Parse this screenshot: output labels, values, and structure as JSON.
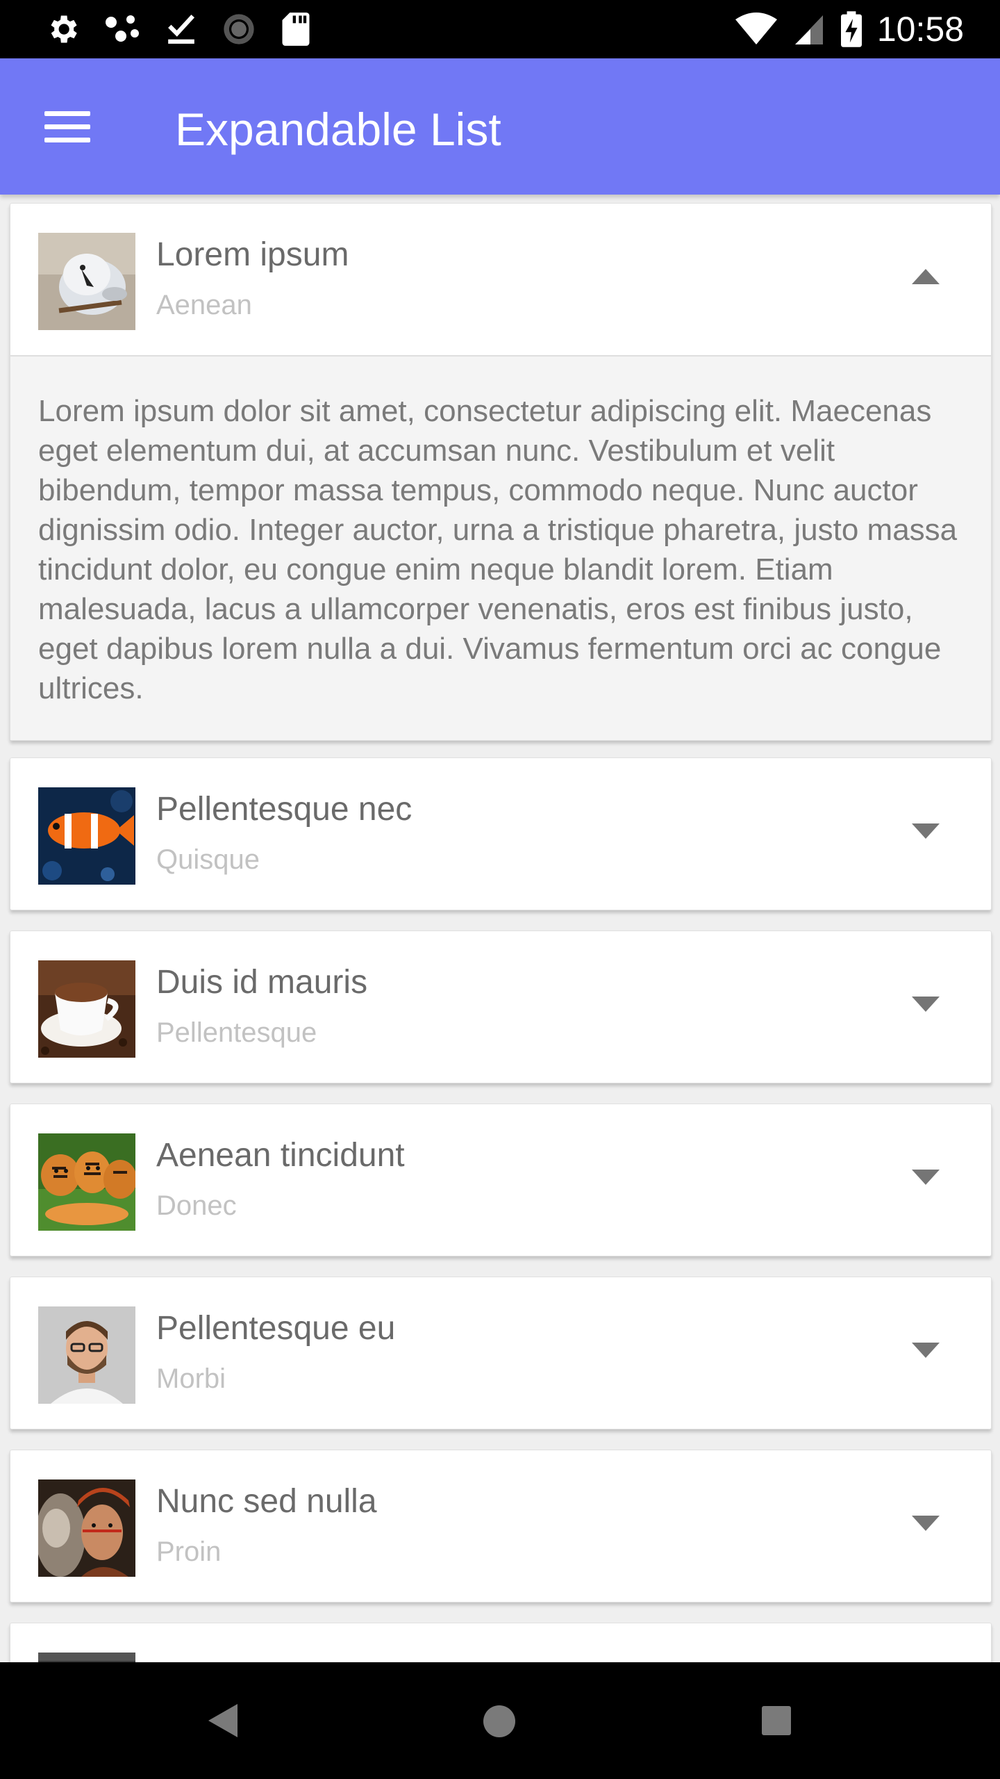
{
  "status_bar": {
    "time": "10:58",
    "icons_left": [
      "settings-icon",
      "dots-icon",
      "download-done-icon",
      "sync-icon",
      "sd-card-icon"
    ],
    "icons_right": [
      "wifi-icon",
      "cell-signal-icon",
      "battery-charging-icon"
    ]
  },
  "app_bar": {
    "title": "Expandable List",
    "menu_icon": "menu-icon"
  },
  "list": {
    "items": [
      {
        "title": "Lorem ipsum",
        "subtitle": "Aenean",
        "expanded": true,
        "body": "Lorem ipsum dolor sit amet, consectetur adipiscing elit. Maecenas eget elementum dui, at accumsan nunc. Vestibulum et velit bibendum, tempor massa tempus, commodo neque. Nunc auctor dignissim odio. Integer auctor, urna a tristique pharetra, justo massa tincidunt dolor, eu congue enim neque blandit lorem. Etiam malesuada, lacus a ullamcorper venenatis, eros est finibus justo, eget dapibus lorem nulla a dui. Vivamus fermentum orci ac congue ultrices."
      },
      {
        "title": "Pellentesque nec",
        "subtitle": "Quisque",
        "expanded": false
      },
      {
        "title": "Duis id mauris",
        "subtitle": "Pellentesque",
        "expanded": false
      },
      {
        "title": "Aenean tincidunt",
        "subtitle": "Donec",
        "expanded": false
      },
      {
        "title": "Pellentesque eu",
        "subtitle": "Morbi",
        "expanded": false
      },
      {
        "title": "Nunc sed nulla",
        "subtitle": "Proin",
        "expanded": false
      }
    ]
  },
  "nav_bar": {
    "icons": [
      "back-icon",
      "home-icon",
      "recents-icon"
    ]
  },
  "colors": {
    "app_bar": "#7178f5",
    "title_text": "#6a6a6a",
    "subtitle_text": "#c2c2c2",
    "expanded_body_bg": "#f4f4f4"
  }
}
